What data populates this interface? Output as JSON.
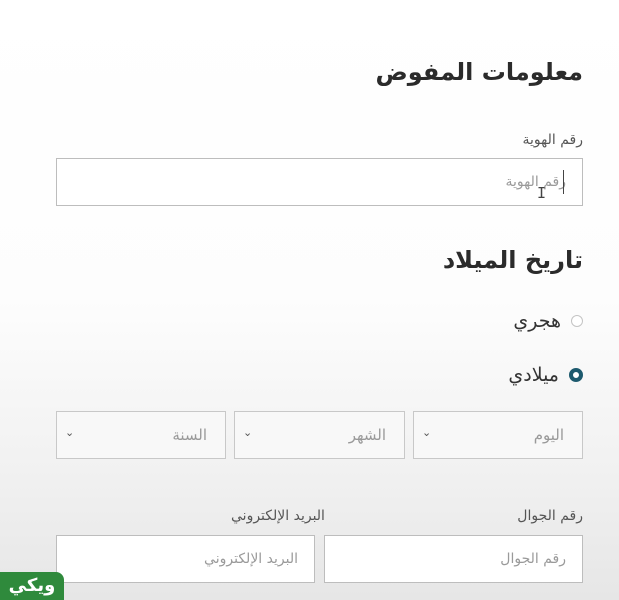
{
  "section_title": "معلومات المفوض",
  "id_field": {
    "label": "رقم الهوية",
    "placeholder": "رقم الهوية"
  },
  "dob": {
    "title": "تاريخ الميلاد",
    "calendar_options": [
      {
        "label": "هجري",
        "selected": false
      },
      {
        "label": "ميلادي",
        "selected": true
      }
    ],
    "day": "اليوم",
    "month": "الشهر",
    "year": "السنة"
  },
  "phone_field": {
    "label": "رقم الجوال",
    "placeholder": "رقم الجوال"
  },
  "email_field": {
    "label": "البريد الإلكتروني",
    "placeholder": "البريد الإلكتروني"
  },
  "watermark": "ويكي",
  "colors": {
    "radio_selected": "#1d5a6e",
    "logo_green": "#2f8a3c"
  }
}
